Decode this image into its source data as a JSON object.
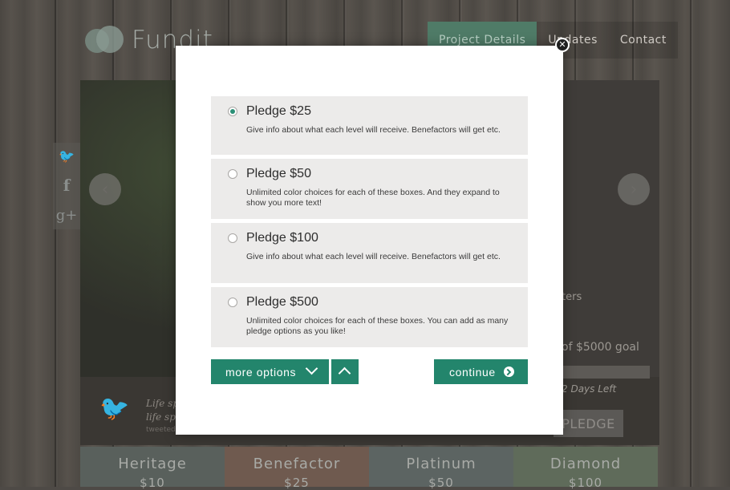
{
  "background": {
    "logo_text": "Fundit",
    "nav": [
      "Project Details",
      "Updates",
      "Contact"
    ],
    "social": [
      "twitter-icon",
      "facebook-icon",
      "google-plus-icon"
    ],
    "backers_fragment": "ters",
    "goal_fragment": "of $5000 goal",
    "days_left": "2 Days Left",
    "pledge_button": "PLEDGE",
    "tweet_quote_line1": "Life sp",
    "tweet_quote_line2": "life spe",
    "tweeted_label": "tweeted",
    "tiers": [
      {
        "name": "Heritage",
        "amount": "$10",
        "color": "#59605c"
      },
      {
        "name": "Benefactor",
        "amount": "$25",
        "color": "#6f5a4f"
      },
      {
        "name": "Platinum",
        "amount": "$50",
        "color": "#5c6462"
      },
      {
        "name": "Diamond",
        "amount": "$100",
        "color": "#5f6b5a"
      }
    ]
  },
  "modal": {
    "close_icon": "close-icon",
    "options": [
      {
        "title": "Pledge $25",
        "description": "Give info about what each level will receive. Benefactors will get etc.",
        "selected": true
      },
      {
        "title": "Pledge $50",
        "description": "Unlimited color choices for each of these boxes. And they expand to show you more text!",
        "selected": false
      },
      {
        "title": "Pledge $100",
        "description": "Give info about what each level will receive. Benefactors will get etc.",
        "selected": false
      },
      {
        "title": "Pledge $500",
        "description": "Unlimited color choices for each of these boxes. You can add as many pledge options as you like!",
        "selected": false
      }
    ],
    "more_options_label": "more options",
    "continue_label": "continue",
    "accent_color": "#23856c"
  }
}
